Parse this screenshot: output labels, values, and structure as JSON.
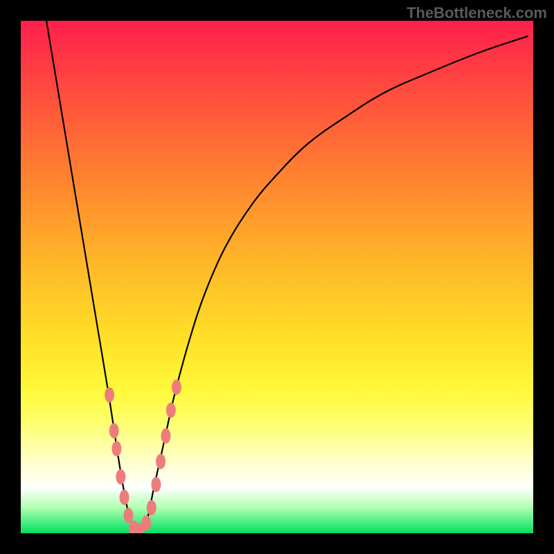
{
  "watermark": "TheBottleneck.com",
  "colors": {
    "frame": "#000000",
    "curve": "#000000",
    "marker": "#ed7d7d"
  },
  "chart_data": {
    "type": "line",
    "title": "",
    "xlabel": "",
    "ylabel": "",
    "xlim": [
      0,
      100
    ],
    "ylim": [
      0,
      100
    ],
    "grid": false,
    "annotations": [
      "TheBottleneck.com"
    ],
    "series": [
      {
        "name": "bottleneck-curve",
        "x": [
          5,
          7,
          9,
          11,
          13,
          15,
          17,
          19,
          20,
          21,
          22,
          23,
          24,
          25,
          26,
          28,
          30,
          33,
          36,
          40,
          45,
          50,
          56,
          63,
          71,
          80,
          90,
          99
        ],
        "y": [
          100,
          88,
          76,
          64,
          52,
          40,
          28,
          15,
          9,
          4,
          1,
          0,
          1,
          4,
          9,
          18,
          27,
          38,
          47,
          56,
          64,
          70,
          76,
          81,
          86,
          90,
          94,
          97
        ]
      }
    ],
    "markers": [
      {
        "name": "left-cluster",
        "points": [
          {
            "x": 17.3,
            "y": 27
          },
          {
            "x": 18.2,
            "y": 20
          },
          {
            "x": 18.7,
            "y": 16.5
          },
          {
            "x": 19.5,
            "y": 11
          },
          {
            "x": 20.2,
            "y": 7
          },
          {
            "x": 21.0,
            "y": 3.5
          },
          {
            "x": 22.0,
            "y": 1
          },
          {
            "x": 23.2,
            "y": 0.5
          }
        ]
      },
      {
        "name": "right-cluster",
        "points": [
          {
            "x": 24.5,
            "y": 2
          },
          {
            "x": 25.5,
            "y": 5
          },
          {
            "x": 26.4,
            "y": 9.5
          },
          {
            "x": 27.3,
            "y": 14
          },
          {
            "x": 28.3,
            "y": 19
          },
          {
            "x": 29.3,
            "y": 24
          },
          {
            "x": 30.4,
            "y": 28.5
          }
        ]
      }
    ],
    "background": {
      "type": "vertical-gradient",
      "stops": [
        {
          "pos": 0.0,
          "color": "#ff1f4a"
        },
        {
          "pos": 0.18,
          "color": "#ff5a3a"
        },
        {
          "pos": 0.48,
          "color": "#ffb928"
        },
        {
          "pos": 0.72,
          "color": "#fff83a"
        },
        {
          "pos": 0.91,
          "color": "#ffffff"
        },
        {
          "pos": 1.0,
          "color": "#00e060"
        }
      ]
    }
  }
}
